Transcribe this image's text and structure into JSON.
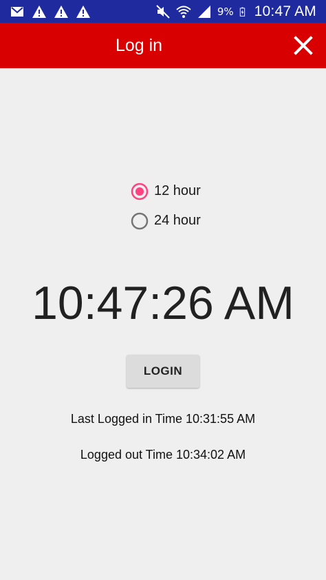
{
  "status_bar": {
    "left_icons": [
      "mail-icon",
      "warning-icon",
      "warning-icon",
      "warning-icon"
    ],
    "right_icons": [
      "mute-icon",
      "wifi-icon",
      "signal-icon"
    ],
    "battery_percent": "9%",
    "time": "10:47 AM"
  },
  "app_bar": {
    "title": "Log in",
    "close_icon": "close-icon",
    "color": "#d80000"
  },
  "time_format": {
    "options": [
      {
        "label": "12 hour",
        "selected": true
      },
      {
        "label": "24 hour",
        "selected": false
      }
    ],
    "accent_color": "#ff4081"
  },
  "clock": {
    "time": "10:47:26 AM"
  },
  "login_button": {
    "label": "LOGIN"
  },
  "session": {
    "last_logged_in": "Last Logged in Time 10:31:55 AM",
    "logged_out": "Logged out Time 10:34:02 AM"
  }
}
